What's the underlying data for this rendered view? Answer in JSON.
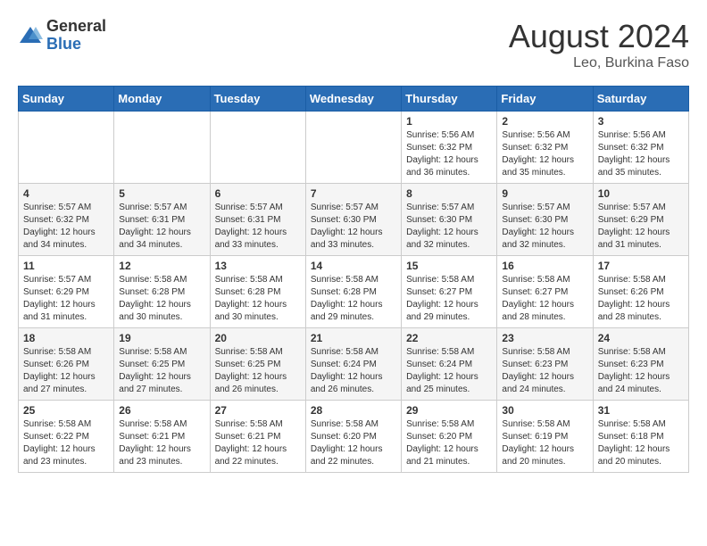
{
  "header": {
    "logo_general": "General",
    "logo_blue": "Blue",
    "month_year": "August 2024",
    "location": "Leo, Burkina Faso"
  },
  "weekdays": [
    "Sunday",
    "Monday",
    "Tuesday",
    "Wednesday",
    "Thursday",
    "Friday",
    "Saturday"
  ],
  "weeks": [
    [
      {
        "day": "",
        "info": ""
      },
      {
        "day": "",
        "info": ""
      },
      {
        "day": "",
        "info": ""
      },
      {
        "day": "",
        "info": ""
      },
      {
        "day": "1",
        "info": "Sunrise: 5:56 AM\nSunset: 6:32 PM\nDaylight: 12 hours\nand 36 minutes."
      },
      {
        "day": "2",
        "info": "Sunrise: 5:56 AM\nSunset: 6:32 PM\nDaylight: 12 hours\nand 35 minutes."
      },
      {
        "day": "3",
        "info": "Sunrise: 5:56 AM\nSunset: 6:32 PM\nDaylight: 12 hours\nand 35 minutes."
      }
    ],
    [
      {
        "day": "4",
        "info": "Sunrise: 5:57 AM\nSunset: 6:32 PM\nDaylight: 12 hours\nand 34 minutes."
      },
      {
        "day": "5",
        "info": "Sunrise: 5:57 AM\nSunset: 6:31 PM\nDaylight: 12 hours\nand 34 minutes."
      },
      {
        "day": "6",
        "info": "Sunrise: 5:57 AM\nSunset: 6:31 PM\nDaylight: 12 hours\nand 33 minutes."
      },
      {
        "day": "7",
        "info": "Sunrise: 5:57 AM\nSunset: 6:30 PM\nDaylight: 12 hours\nand 33 minutes."
      },
      {
        "day": "8",
        "info": "Sunrise: 5:57 AM\nSunset: 6:30 PM\nDaylight: 12 hours\nand 32 minutes."
      },
      {
        "day": "9",
        "info": "Sunrise: 5:57 AM\nSunset: 6:30 PM\nDaylight: 12 hours\nand 32 minutes."
      },
      {
        "day": "10",
        "info": "Sunrise: 5:57 AM\nSunset: 6:29 PM\nDaylight: 12 hours\nand 31 minutes."
      }
    ],
    [
      {
        "day": "11",
        "info": "Sunrise: 5:57 AM\nSunset: 6:29 PM\nDaylight: 12 hours\nand 31 minutes."
      },
      {
        "day": "12",
        "info": "Sunrise: 5:58 AM\nSunset: 6:28 PM\nDaylight: 12 hours\nand 30 minutes."
      },
      {
        "day": "13",
        "info": "Sunrise: 5:58 AM\nSunset: 6:28 PM\nDaylight: 12 hours\nand 30 minutes."
      },
      {
        "day": "14",
        "info": "Sunrise: 5:58 AM\nSunset: 6:28 PM\nDaylight: 12 hours\nand 29 minutes."
      },
      {
        "day": "15",
        "info": "Sunrise: 5:58 AM\nSunset: 6:27 PM\nDaylight: 12 hours\nand 29 minutes."
      },
      {
        "day": "16",
        "info": "Sunrise: 5:58 AM\nSunset: 6:27 PM\nDaylight: 12 hours\nand 28 minutes."
      },
      {
        "day": "17",
        "info": "Sunrise: 5:58 AM\nSunset: 6:26 PM\nDaylight: 12 hours\nand 28 minutes."
      }
    ],
    [
      {
        "day": "18",
        "info": "Sunrise: 5:58 AM\nSunset: 6:26 PM\nDaylight: 12 hours\nand 27 minutes."
      },
      {
        "day": "19",
        "info": "Sunrise: 5:58 AM\nSunset: 6:25 PM\nDaylight: 12 hours\nand 27 minutes."
      },
      {
        "day": "20",
        "info": "Sunrise: 5:58 AM\nSunset: 6:25 PM\nDaylight: 12 hours\nand 26 minutes."
      },
      {
        "day": "21",
        "info": "Sunrise: 5:58 AM\nSunset: 6:24 PM\nDaylight: 12 hours\nand 26 minutes."
      },
      {
        "day": "22",
        "info": "Sunrise: 5:58 AM\nSunset: 6:24 PM\nDaylight: 12 hours\nand 25 minutes."
      },
      {
        "day": "23",
        "info": "Sunrise: 5:58 AM\nSunset: 6:23 PM\nDaylight: 12 hours\nand 24 minutes."
      },
      {
        "day": "24",
        "info": "Sunrise: 5:58 AM\nSunset: 6:23 PM\nDaylight: 12 hours\nand 24 minutes."
      }
    ],
    [
      {
        "day": "25",
        "info": "Sunrise: 5:58 AM\nSunset: 6:22 PM\nDaylight: 12 hours\nand 23 minutes."
      },
      {
        "day": "26",
        "info": "Sunrise: 5:58 AM\nSunset: 6:21 PM\nDaylight: 12 hours\nand 23 minutes."
      },
      {
        "day": "27",
        "info": "Sunrise: 5:58 AM\nSunset: 6:21 PM\nDaylight: 12 hours\nand 22 minutes."
      },
      {
        "day": "28",
        "info": "Sunrise: 5:58 AM\nSunset: 6:20 PM\nDaylight: 12 hours\nand 22 minutes."
      },
      {
        "day": "29",
        "info": "Sunrise: 5:58 AM\nSunset: 6:20 PM\nDaylight: 12 hours\nand 21 minutes."
      },
      {
        "day": "30",
        "info": "Sunrise: 5:58 AM\nSunset: 6:19 PM\nDaylight: 12 hours\nand 20 minutes."
      },
      {
        "day": "31",
        "info": "Sunrise: 5:58 AM\nSunset: 6:18 PM\nDaylight: 12 hours\nand 20 minutes."
      }
    ]
  ]
}
